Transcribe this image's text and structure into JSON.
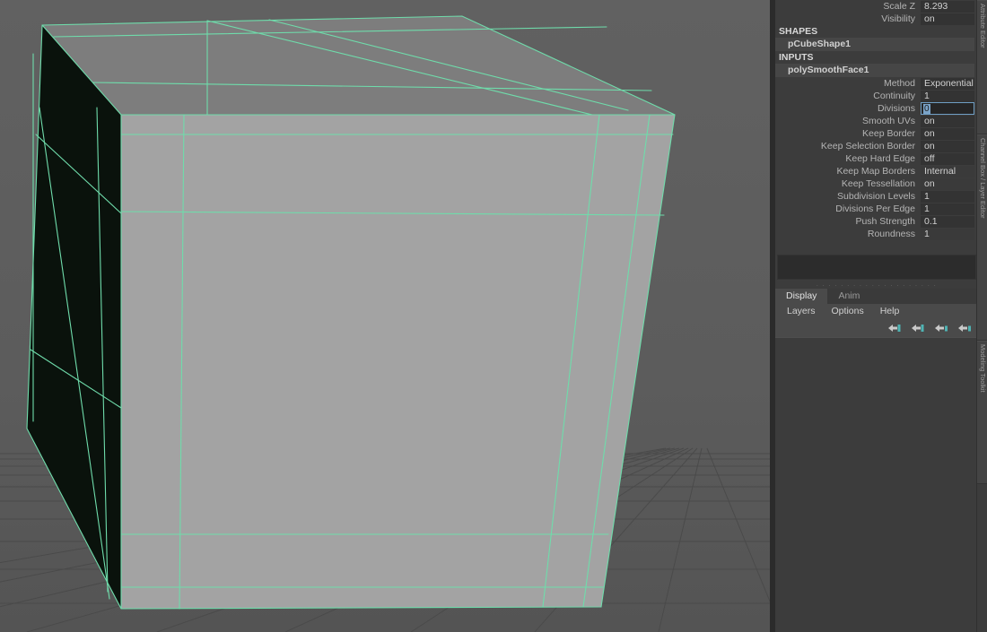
{
  "app": {
    "name": "Maya Viewport and Channel Box",
    "viewport_bg": "#5b5b5b",
    "wire_color": "#7fe0b0",
    "panel_bg": "#3c3c3c",
    "accent": "#6f9ec4"
  },
  "channel_box": {
    "transform_attrs": [
      {
        "label": "Scale Z",
        "value": "8.293",
        "state": "normal"
      },
      {
        "label": "Visibility",
        "value": "on",
        "state": "normal"
      }
    ],
    "shapes_header": "SHAPES",
    "shape_node": "pCubeShape1",
    "inputs_header": "INPUTS",
    "input_node": "polySmoothFace1",
    "input_attrs": [
      {
        "label": "Method",
        "value": "Exponential",
        "state": "normal"
      },
      {
        "label": "Continuity",
        "value": "1",
        "state": "normal"
      },
      {
        "label": "Divisions",
        "value": "0",
        "state": "active"
      },
      {
        "label": "Smooth UVs",
        "value": "on",
        "state": "normal"
      },
      {
        "label": "Keep Border",
        "value": "on",
        "state": "normal"
      },
      {
        "label": "Keep Selection Border",
        "value": "on",
        "state": "normal"
      },
      {
        "label": "Keep Hard Edge",
        "value": "off",
        "state": "normal"
      },
      {
        "label": "Keep Map Borders",
        "value": "Internal",
        "state": "alt"
      },
      {
        "label": "Keep Tessellation",
        "value": "on",
        "state": "alt"
      },
      {
        "label": "Subdivision Levels",
        "value": "1",
        "state": "normal"
      },
      {
        "label": "Divisions Per Edge",
        "value": "1",
        "state": "normal"
      },
      {
        "label": "Push Strength",
        "value": "0.1",
        "state": "normal"
      },
      {
        "label": "Roundness",
        "value": "1",
        "state": "alt"
      }
    ]
  },
  "drag_handle_dots": ". . . . . . . . . . . . . . . . . . . .",
  "layer_editor": {
    "tabs": [
      {
        "label": "Display",
        "active": true
      },
      {
        "label": "Anim",
        "active": false
      }
    ],
    "menus": [
      "Layers",
      "Options",
      "Help"
    ],
    "toolbar_icons": [
      "layer-new-icon",
      "layer-new-from-selected-icon",
      "layer-empty-above-icon",
      "layer-empty-below-icon"
    ],
    "icon_color": "#4fb3b3"
  },
  "side_tabs": [
    {
      "label": "Attribute Editor"
    },
    {
      "label": "Channel Box / Layer Editor"
    },
    {
      "label": "Modeling Toolkit"
    }
  ],
  "viewport": {
    "object": "pCube1",
    "shading": "smooth-shaded",
    "wireframe_on_shaded": true,
    "grid_visible": true
  }
}
